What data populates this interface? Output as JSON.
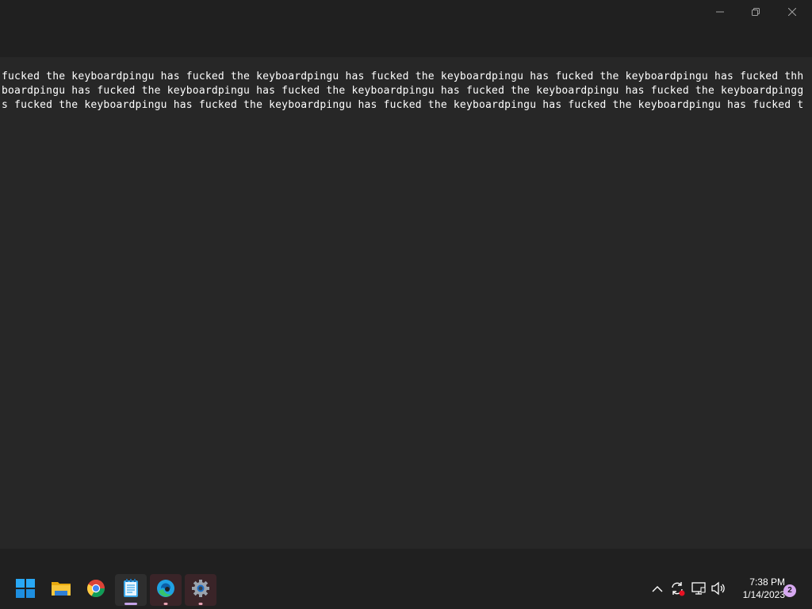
{
  "window": {
    "controls": {
      "minimize_icon": "minimize-icon",
      "maximize_icon": "restore-icon",
      "close_icon": "close-icon"
    }
  },
  "editor": {
    "lines": [
      "fucked the keyboardpingu has fucked the keyboardpingu has fucked the keyboardpingu has fucked the keyboardpingu has fucked thh",
      "boardpingu has fucked the keyboardpingu has fucked the keyboardpingu has fucked the keyboardpingu has fucked the keyboardpingg",
      "s fucked the keyboardpingu has fucked the keyboardpingu has fucked the keyboardpingu has fucked the keyboardpingu has fucked t"
    ]
  },
  "taskbar": {
    "apps": [
      {
        "name": "start",
        "icon": "windows-logo-icon",
        "state": "none"
      },
      {
        "name": "file-explorer",
        "icon": "folder-icon",
        "state": "none"
      },
      {
        "name": "chrome",
        "icon": "chrome-icon",
        "state": "none"
      },
      {
        "name": "notepad",
        "icon": "notepad-icon",
        "state": "active"
      },
      {
        "name": "edge",
        "icon": "edge-icon",
        "state": "running"
      },
      {
        "name": "settings",
        "icon": "gear-icon",
        "state": "running"
      }
    ],
    "tray": {
      "icons": [
        "chevron-up-icon",
        "sync-icon",
        "network-icon",
        "volume-icon"
      ],
      "time": "7:38 PM",
      "date": "1/14/2023",
      "notification_count": "2"
    }
  },
  "colors": {
    "editor_bg": "#272727",
    "titlebar_bg": "#202020",
    "taskbar_bg": "#202020",
    "text": "#ffffff",
    "notification_badge": "#d6a8f0"
  }
}
